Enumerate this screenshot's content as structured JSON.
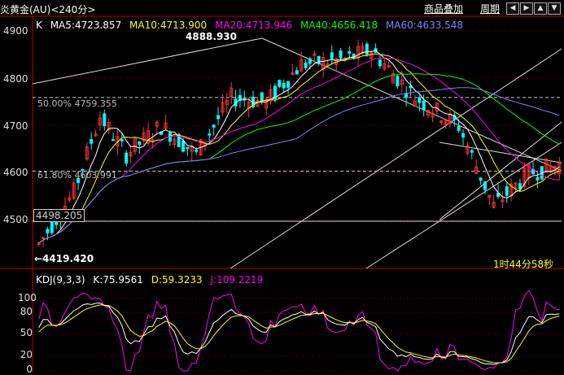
{
  "header": {
    "title": "炎黄金(AU)<240分>",
    "buttons": {
      "product": "商品叠加",
      "period": "周期"
    },
    "window_buttons": [
      "◀",
      "▶",
      "▲",
      "▼"
    ]
  },
  "main_indicator": {
    "k_label": "K",
    "ma5": "MA5:4723.857",
    "ma10": "MA10:4713.900",
    "ma20": "MA20:4713.946",
    "ma40": "MA40:4656.418",
    "ma60": "MA60:4633.548",
    "colors": {
      "ma5": "#ffffff",
      "ma10": "#ffff00",
      "ma20": "#ff00ff",
      "ma40": "#00ff00",
      "ma60": "#8080ff"
    },
    "y_ticks": [
      "4900",
      "4800",
      "4700",
      "4600",
      "4500"
    ],
    "fib_50": "50.00% 4759.355",
    "fib_618": "61.80% 4603.991",
    "boxed_price": "4498.205",
    "high_label": "4888.930",
    "low_label": "←4419.420",
    "timer": "1时44分58秒",
    "up_color": "#ff3030",
    "down_color": "#00ffff"
  },
  "sub_indicator": {
    "title": "KDJ(9,3,3)",
    "k": "K:75.9561",
    "d": "D:59.3233",
    "j": "J:109.2219",
    "y_ticks": [
      "100",
      "80",
      "50",
      "20",
      "0"
    ],
    "colors": {
      "k": "#ffffff",
      "d": "#ffff00",
      "j": "#ff00ff"
    }
  },
  "chart_data": {
    "type": "candlestick",
    "y_range": [
      4419,
      4900
    ],
    "kdj_range": [
      0,
      110
    ],
    "candle_count": 120,
    "levels": {
      "fib_50": 4759.355,
      "fib_618": 4603.991,
      "boxed": 4498.205,
      "high": 4888.93,
      "low": 4419.42
    }
  }
}
